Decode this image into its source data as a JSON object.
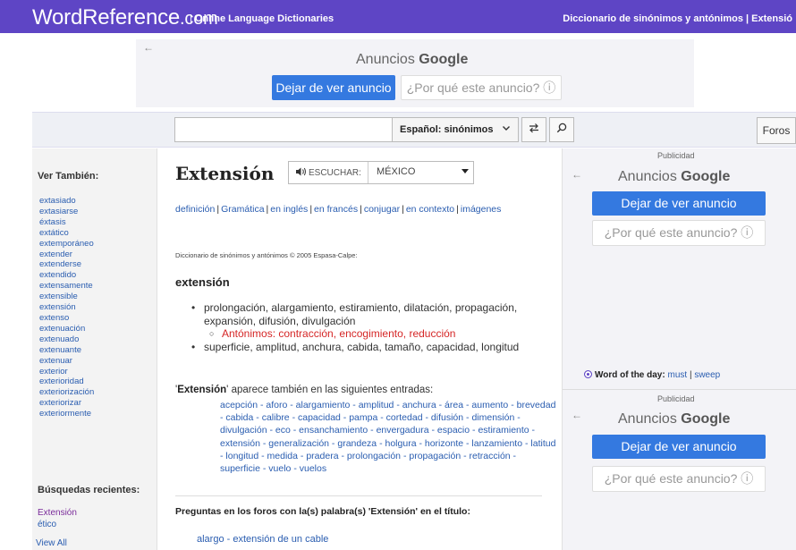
{
  "header": {
    "logo_main": "WordReference",
    "logo_tld": ".com",
    "logo_sep": "|",
    "logo_sub": "Online Language Dictionaries",
    "right_text": "Diccionario de sinónimos y antónimos | Extensió"
  },
  "ads": {
    "back_glyph": "←",
    "brand_prefix": "Anuncios",
    "brand_name": "Google",
    "stop_label": "Dejar de ver anuncio",
    "why_label": "¿Por qué este anuncio? ⓘ",
    "publicidad": "Publicidad",
    "colors": {
      "button_blue": "#3479e0",
      "header_purple": "#5e45c5"
    }
  },
  "searchbar": {
    "input_value": "",
    "dictionary_selected": "Español: sinónimos",
    "chevron_icon": "chevron-down-icon",
    "swap_icon": "swap-icon",
    "search_icon": "search-icon",
    "foros_label": "Foros"
  },
  "sidebar": {
    "see_also_heading": "Ver También:",
    "related": [
      "extasiado",
      "extasiarse",
      "éxtasis",
      "extático",
      "extemporáneo",
      "extender",
      "extenderse",
      "extendido",
      "extensamente",
      "extensible",
      "extensión",
      "extenso",
      "extenuación",
      "extenuado",
      "extenuante",
      "extenuar",
      "exterior",
      "exterioridad",
      "exteriorización",
      "exteriorizar",
      "exteriormente"
    ],
    "recent_heading": "Búsquedas recientes:",
    "recent": [
      "Extensión",
      "ético"
    ],
    "recent_colors": [
      "#7a2b9a",
      "#2a5db0"
    ],
    "view_all": "View All"
  },
  "main": {
    "headword": "Extensión",
    "listen_label": "ESCUCHAR:",
    "accent_selected": "MÉXICO",
    "links": [
      "definición",
      "Gramática",
      "en inglés",
      "en francés",
      "conjugar",
      "en contexto",
      "imágenes"
    ],
    "copyright": "Diccionario de sinónimos y antónimos © 2005 Espasa-Calpe:",
    "entry_word": "extensión",
    "senses": [
      "prolongación, alargamiento, estiramiento, dilatación, propagación, expansión, difusión, divulgación",
      "superficie, amplitud, anchura, cabida, tamaño, capacidad, longitud"
    ],
    "antonyms": "Antónimos: contracción, encogimiento, reducción",
    "also_prefix": "'",
    "also_word": "Extensión",
    "also_suffix": "' aparece también en las siguientes entradas:",
    "also_entries": [
      "acepción",
      "aforo",
      "alargamiento",
      "amplitud",
      "anchura",
      "área",
      "aumento",
      "brevedad",
      "cabida",
      "calibre",
      "capacidad",
      "pampa",
      "cortedad",
      "difusión",
      "dimensión",
      "divulgación",
      "eco",
      "ensanchamiento",
      "envergadura",
      "espacio",
      "estiramiento",
      "extensión",
      "generalización",
      "grandeza",
      "holgura",
      "horizonte",
      "lanzamiento",
      "latitud",
      "longitud",
      "medida",
      "pradera",
      "prolongación",
      "propagación",
      "retracción",
      "superficie",
      "vuelo",
      "vuelos"
    ],
    "forums_heading": "Preguntas en los foros con la(s) palabra(s) 'Extensión' en el título:",
    "forum_link": "alargo - extensión de un cable"
  },
  "wotd": {
    "label": "Word of the day:",
    "word1": "must",
    "sep": "|",
    "word2": "sweep"
  }
}
